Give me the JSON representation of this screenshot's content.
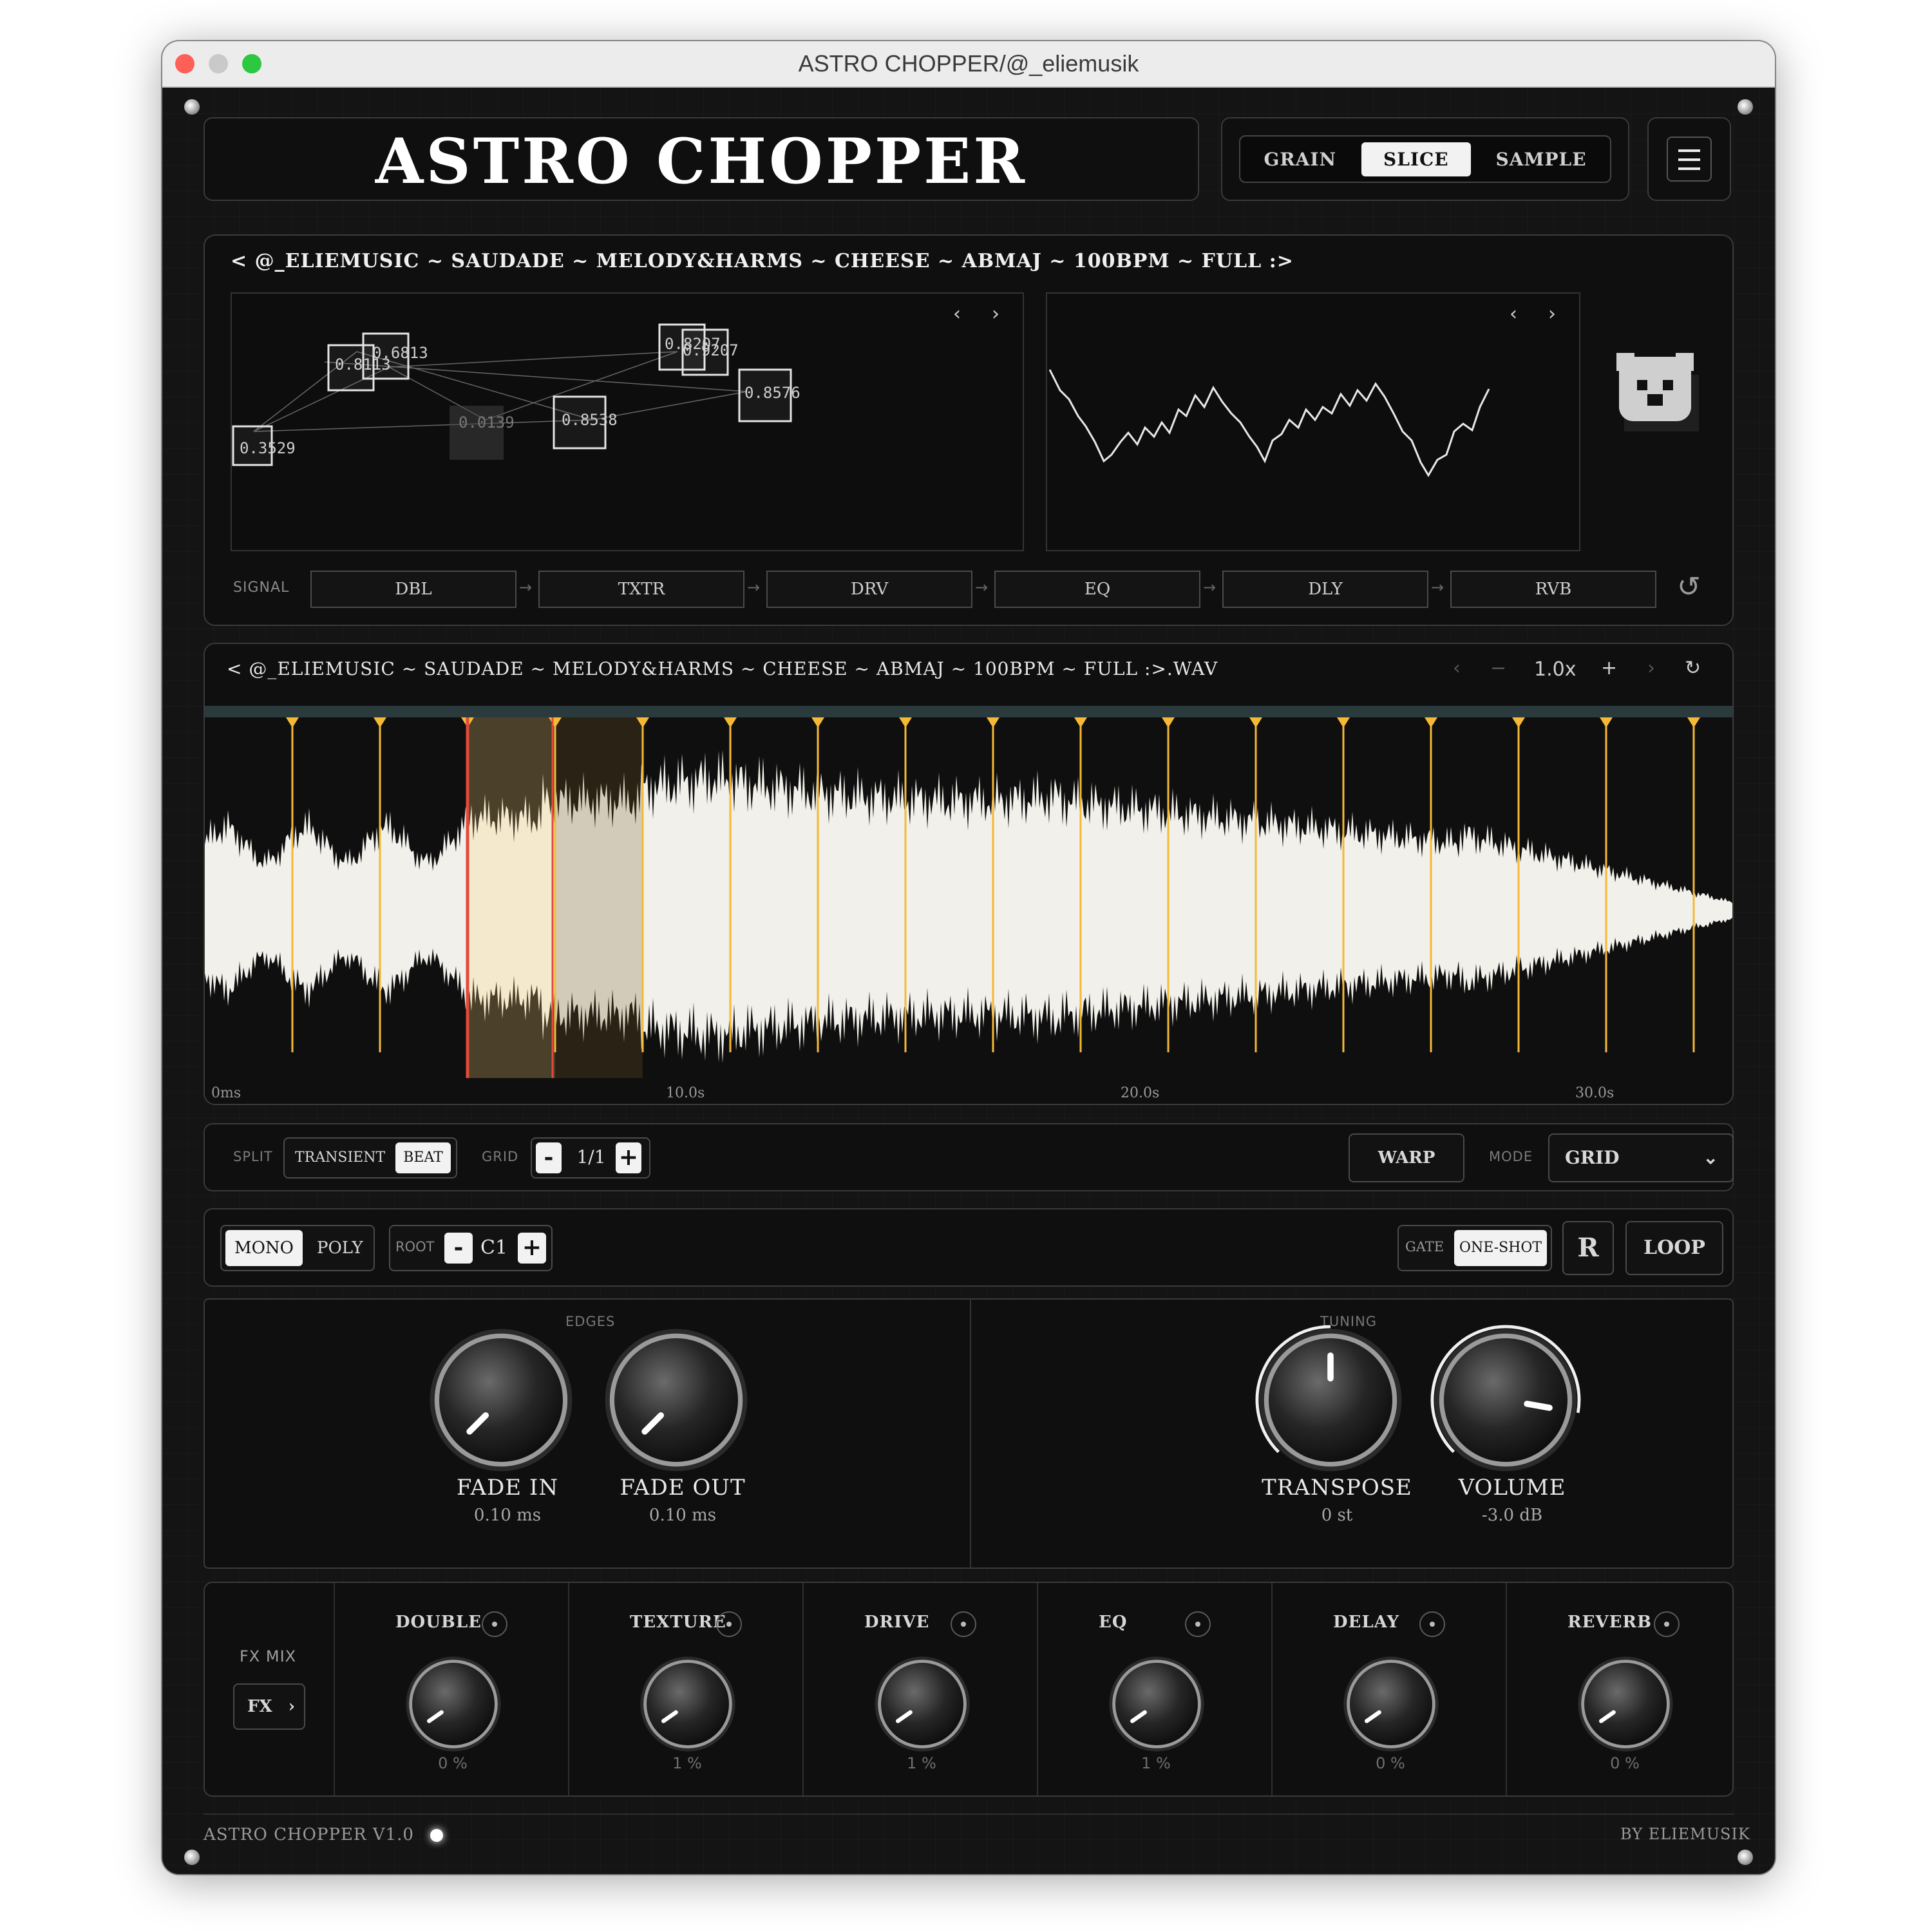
{
  "window": {
    "title": "ASTRO CHOPPER/@_eliemusik"
  },
  "header": {
    "brand": "ASTRO CHOPPER",
    "modes": [
      "GRAIN",
      "SLICE",
      "SAMPLE"
    ],
    "active_mode": "SLICE"
  },
  "preset": {
    "title": "< @_ELIEMUSIC ~ SAUDADE ~ MELODY&HARMS ~ CHEESE ~ ABMAJ ~ 100BPM ~ FULL :>",
    "nodes": [
      "0.8113",
      "0.6813",
      "0.8207",
      "0.9207",
      "0.8576",
      "0.8538",
      "0.0139",
      "0.3529"
    ],
    "signal_label": "SIGNAL",
    "signal_chain": [
      "DBL",
      "TXTR",
      "DRV",
      "EQ",
      "DLY",
      "RVB"
    ]
  },
  "waveform": {
    "file": "< @_ELIEMUSIC ~ SAUDADE ~ MELODY&HARMS ~ CHEESE ~ ABMAJ ~ 100BPM ~ FULL :>.WAV",
    "zoom": "1.0x",
    "time_labels": [
      "0ms",
      "10.0s",
      "20.0s",
      "30.0s"
    ],
    "slice_count": 17,
    "marker_color": "#f5b935",
    "playhead_color": "#e14a3c"
  },
  "slice_controls": {
    "split_label": "SPLIT",
    "split_options": [
      "TRANSIENT",
      "BEAT"
    ],
    "split_active": "BEAT",
    "grid_label": "GRID",
    "grid_value": "1/1",
    "warp": "WARP",
    "mode_label": "MODE",
    "mode_value": "GRID"
  },
  "play_controls": {
    "voice_options": [
      "MONO",
      "POLY"
    ],
    "voice_active": "MONO",
    "root_label": "ROOT",
    "root_value": "C1",
    "gate_label": "GATE",
    "gate_value": "ONE-SHOT",
    "reverse": "R",
    "loop": "LOOP"
  },
  "edges": {
    "label": "EDGES",
    "knobs": [
      {
        "name": "FADE IN",
        "value": "0.10 ms"
      },
      {
        "name": "FADE OUT",
        "value": "0.10 ms"
      }
    ]
  },
  "tuning": {
    "label": "TUNING",
    "knobs": [
      {
        "name": "TRANSPOSE",
        "value": "0 st"
      },
      {
        "name": "VOLUME",
        "value": "-3.0 dB"
      }
    ]
  },
  "fx": {
    "mix_label": "FX MIX",
    "mix_button": "FX",
    "channels": [
      {
        "name": "DOUBLE",
        "value": "0 %"
      },
      {
        "name": "TEXTURE",
        "value": "1 %"
      },
      {
        "name": "DRIVE",
        "value": "1 %"
      },
      {
        "name": "EQ",
        "value": "1 %"
      },
      {
        "name": "DELAY",
        "value": "0 %"
      },
      {
        "name": "REVERB",
        "value": "0 %"
      }
    ]
  },
  "footer": {
    "version": "ASTRO CHOPPER V1.0",
    "credit": "BY ELIEMUSIK"
  }
}
